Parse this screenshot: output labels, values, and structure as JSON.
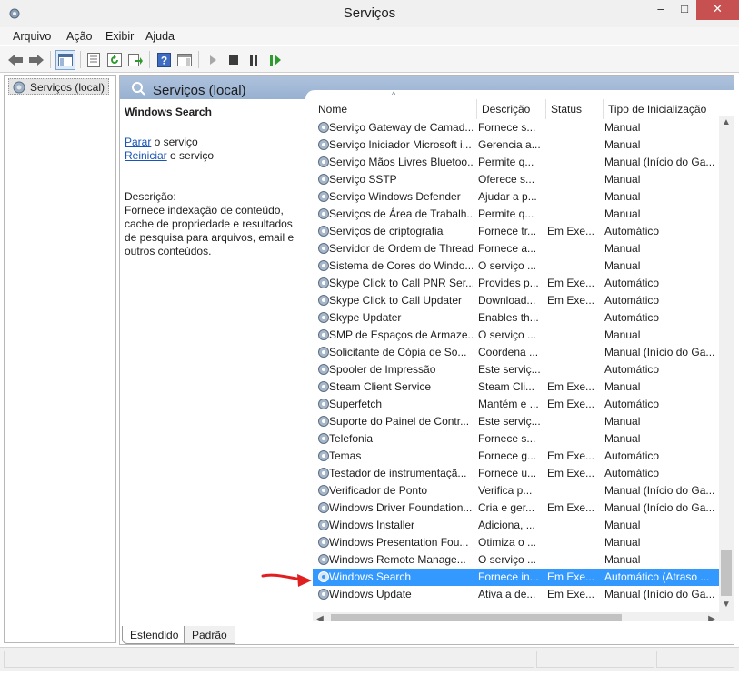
{
  "window": {
    "title": "Serviços",
    "min_label": "–",
    "max_label": "□",
    "close_label": "✕"
  },
  "menu": {
    "items": [
      "Arquivo",
      "Ação",
      "Exibir",
      "Ajuda"
    ]
  },
  "toolbar": {
    "icons": [
      "back-icon",
      "forward-icon",
      "show-hide-console-tree-icon",
      "properties-icon",
      "refresh-icon",
      "export-list-icon",
      "help-icon",
      "show-hide-action-pane-icon",
      "start-service-icon",
      "stop-service-icon",
      "pause-service-icon",
      "restart-service-icon"
    ]
  },
  "tree": {
    "root_label": "Serviços (local)"
  },
  "header": {
    "title": "Serviços (local)"
  },
  "details": {
    "service_name": "Windows Search",
    "stop_link": "Parar",
    "stop_suffix": " o serviço",
    "restart_link": "Reiniciar",
    "restart_suffix": " o serviço",
    "description_label": "Descrição:",
    "description_text": "Fornece indexação de conteúdo, cache de propriedade e resultados de pesquisa para arquivos, email e outros conteúdos."
  },
  "list": {
    "columns": {
      "name": "Nome",
      "description": "Descrição",
      "status": "Status",
      "startup": "Tipo de Inicialização"
    },
    "selected_index": 26,
    "rows": [
      {
        "name": "Serviço Gateway de Camad...",
        "description": "Fornece s...",
        "status": "",
        "startup": "Manual"
      },
      {
        "name": "Serviço Iniciador Microsoft i...",
        "description": "Gerencia a...",
        "status": "",
        "startup": "Manual"
      },
      {
        "name": "Serviço Mãos Livres Bluetoo...",
        "description": "Permite q...",
        "status": "",
        "startup": "Manual (Início do Ga..."
      },
      {
        "name": "Serviço SSTP",
        "description": "Oferece s...",
        "status": "",
        "startup": "Manual"
      },
      {
        "name": "Serviço Windows Defender",
        "description": "Ajudar a p...",
        "status": "",
        "startup": "Manual"
      },
      {
        "name": "Serviços de Área de Trabalh...",
        "description": "Permite q...",
        "status": "",
        "startup": "Manual"
      },
      {
        "name": "Serviços de criptografia",
        "description": "Fornece tr...",
        "status": "Em Exe...",
        "startup": "Automático"
      },
      {
        "name": "Servidor de Ordem de Thread",
        "description": "Fornece a...",
        "status": "",
        "startup": "Manual"
      },
      {
        "name": "Sistema de Cores do Windo...",
        "description": "O serviço ...",
        "status": "",
        "startup": "Manual"
      },
      {
        "name": "Skype Click to Call PNR Ser...",
        "description": "Provides p...",
        "status": "Em Exe...",
        "startup": "Automático"
      },
      {
        "name": "Skype Click to Call Updater",
        "description": "Download...",
        "status": "Em Exe...",
        "startup": "Automático"
      },
      {
        "name": "Skype Updater",
        "description": "Enables th...",
        "status": "",
        "startup": "Automático"
      },
      {
        "name": "SMP de Espaços de Armaze...",
        "description": "O serviço ...",
        "status": "",
        "startup": "Manual"
      },
      {
        "name": "Solicitante de Cópia de So...",
        "description": "Coordena ...",
        "status": "",
        "startup": "Manual (Início do Ga..."
      },
      {
        "name": "Spooler de Impressão",
        "description": "Este serviç...",
        "status": "",
        "startup": "Automático"
      },
      {
        "name": "Steam Client Service",
        "description": "Steam Cli...",
        "status": "Em Exe...",
        "startup": "Manual"
      },
      {
        "name": "Superfetch",
        "description": "Mantém e ...",
        "status": "Em Exe...",
        "startup": "Automático"
      },
      {
        "name": "Suporte do Painel de Contr...",
        "description": "Este serviç...",
        "status": "",
        "startup": "Manual"
      },
      {
        "name": "Telefonia",
        "description": "Fornece s...",
        "status": "",
        "startup": "Manual"
      },
      {
        "name": "Temas",
        "description": "Fornece g...",
        "status": "Em Exe...",
        "startup": "Automático"
      },
      {
        "name": "Testador de instrumentaçã...",
        "description": "Fornece u...",
        "status": "Em Exe...",
        "startup": "Automático"
      },
      {
        "name": "Verificador de Ponto",
        "description": "Verifica p...",
        "status": "",
        "startup": "Manual (Início do Ga..."
      },
      {
        "name": "Windows Driver Foundation...",
        "description": "Cria e ger...",
        "status": "Em Exe...",
        "startup": "Manual (Início do Ga..."
      },
      {
        "name": "Windows Installer",
        "description": "Adiciona, ...",
        "status": "",
        "startup": "Manual"
      },
      {
        "name": "Windows Presentation Fou...",
        "description": "Otimiza o ...",
        "status": "",
        "startup": "Manual"
      },
      {
        "name": "Windows Remote Manage...",
        "description": "O serviço ...",
        "status": "",
        "startup": "Manual"
      },
      {
        "name": "Windows Search",
        "description": "Fornece in...",
        "status": "Em Exe...",
        "startup": "Automático (Atraso ..."
      },
      {
        "name": "Windows Update",
        "description": "Ativa a de...",
        "status": "Em Exe...",
        "startup": "Manual (Início do Ga..."
      }
    ]
  },
  "tabs": {
    "extended": "Estendido",
    "standard": "Padrão"
  },
  "colors": {
    "selection": "#3399ff",
    "header_band": "#a4bbd7",
    "link": "#1a55b5",
    "annotation_arrow": "#e02020"
  }
}
